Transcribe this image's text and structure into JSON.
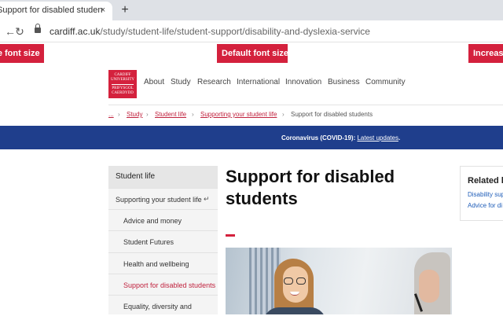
{
  "browser": {
    "tab_title": "Support for disabled students - C",
    "tab_close": "×",
    "new_tab": "+",
    "back": "←",
    "reload": "↻",
    "url_host": "cardiff.ac.uk",
    "url_path": "/study/student-life/student-support/disability-and-dyslexia-service"
  },
  "font_controls": {
    "decrease_label": "Decrease font size",
    "default_label": "Default font size",
    "increase_label": "Increase font size"
  },
  "logo": {
    "lines": [
      "CARDIFF",
      "UNIVERSITY",
      "PRIFYSGOL",
      "CAERDYDD"
    ]
  },
  "nav": {
    "items": [
      "About",
      "Study",
      "Research",
      "International",
      "Innovation",
      "Business",
      "Community"
    ]
  },
  "breadcrumb": {
    "items": [
      "...",
      "Study",
      "Student life",
      "Supporting your student life",
      "Support for disabled students"
    ],
    "separator": "›"
  },
  "banner": {
    "label": "Coronavirus (COVID-19):",
    "link": "Latest updates",
    "end": "."
  },
  "sidebar": {
    "heading": "Student life",
    "items": [
      {
        "label": "Supporting your student life",
        "arrow": "↵"
      },
      {
        "label": "Advice and money"
      },
      {
        "label": "Student Futures"
      },
      {
        "label": "Health and wellbeing"
      },
      {
        "label": "Support for disabled students"
      },
      {
        "label": "Equality, diversity and"
      }
    ]
  },
  "main": {
    "title_line1": "Support for disabled",
    "title_line2": "students"
  },
  "related": {
    "title": "Related li",
    "links": [
      "Disability sup",
      "Advice for di"
    ]
  },
  "colors": {
    "brand_red": "#d4213d",
    "banner_blue": "#1f3e8c"
  }
}
